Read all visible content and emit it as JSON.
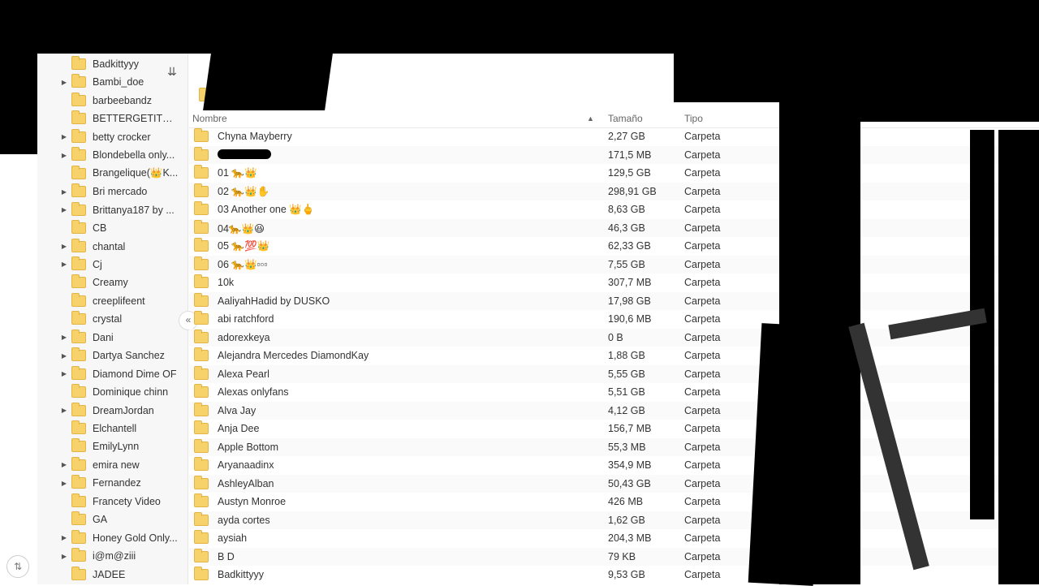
{
  "toolbar": {
    "sort_icon": "sort-icon",
    "collapse_icon": "double-chevron-left-icon",
    "corner_icon": "refresh-icon"
  },
  "sidebar": {
    "items": [
      {
        "label": "Badkittyyy",
        "expandable": false
      },
      {
        "label": "Bambi_doe",
        "expandable": true
      },
      {
        "label": "barbeebandz",
        "expandable": false
      },
      {
        "label": "BETTERGETITRI...",
        "expandable": false
      },
      {
        "label": "betty crocker",
        "expandable": true
      },
      {
        "label": "Blondebella only...",
        "expandable": true
      },
      {
        "label": "Brangelique(👑K...",
        "expandable": false
      },
      {
        "label": "Bri mercado",
        "expandable": true
      },
      {
        "label": "Brittanya187 by ...",
        "expandable": true
      },
      {
        "label": "CB",
        "expandable": false
      },
      {
        "label": "chantal",
        "expandable": true
      },
      {
        "label": "Cj",
        "expandable": true
      },
      {
        "label": "Creamy",
        "expandable": false
      },
      {
        "label": "creeplifeent",
        "expandable": false
      },
      {
        "label": "crystal",
        "expandable": false
      },
      {
        "label": "Dani",
        "expandable": true
      },
      {
        "label": "Dartya Sanchez",
        "expandable": true
      },
      {
        "label": "Diamond Dime OF",
        "expandable": true
      },
      {
        "label": "Dominique chinn",
        "expandable": false
      },
      {
        "label": "DreamJordan",
        "expandable": true
      },
      {
        "label": "Elchantell",
        "expandable": false
      },
      {
        "label": "EmilyLynn",
        "expandable": false
      },
      {
        "label": "emira new",
        "expandable": true
      },
      {
        "label": "Fernandez",
        "expandable": true
      },
      {
        "label": "Francety Video",
        "expandable": false
      },
      {
        "label": "GA",
        "expandable": false
      },
      {
        "label": "Honey Gold Only...",
        "expandable": true
      },
      {
        "label": "i@m@ziii",
        "expandable": true
      },
      {
        "label": "JADEE",
        "expandable": false
      }
    ]
  },
  "table": {
    "columns": {
      "name": "Nombre",
      "size": "Tamaño",
      "type": "Tipo"
    },
    "rows": [
      {
        "name": "Chyna Mayberry",
        "size": "2,27 GB",
        "type": "Carpeta"
      },
      {
        "name": "",
        "size": "171,5 MB",
        "type": "Carpeta"
      },
      {
        "name": "01 🐆👑",
        "size": "129,5 GB",
        "type": "Carpeta"
      },
      {
        "name": "02 🐆👑✋",
        "size": "298,91 GB",
        "type": "Carpeta"
      },
      {
        "name": "03 Another one 👑🖕",
        "size": "8,63 GB",
        "type": "Carpeta"
      },
      {
        "name": "04🐆👑😆",
        "size": "46,3 GB",
        "type": "Carpeta"
      },
      {
        "name": "05 🐆💯👑",
        "size": "62,33 GB",
        "type": "Carpeta"
      },
      {
        "name": "06 🐆👑▫▫▫",
        "size": "7,55 GB",
        "type": "Carpeta"
      },
      {
        "name": "10k",
        "size": "307,7 MB",
        "type": "Carpeta"
      },
      {
        "name": "AaliyahHadid by DUSKO",
        "size": "17,98 GB",
        "type": "Carpeta"
      },
      {
        "name": "abi ratchford",
        "size": "190,6 MB",
        "type": "Carpeta"
      },
      {
        "name": "adorexkeya",
        "size": "0 B",
        "type": "Carpeta"
      },
      {
        "name": "Alejandra Mercedes DiamondKay",
        "size": "1,88 GB",
        "type": "Carpeta"
      },
      {
        "name": "Alexa Pearl",
        "size": "5,55 GB",
        "type": "Carpeta"
      },
      {
        "name": "Alexas onlyfans",
        "size": "5,51 GB",
        "type": "Carpeta"
      },
      {
        "name": "Alva Jay",
        "size": "4,12 GB",
        "type": "Carpeta"
      },
      {
        "name": "Anja Dee",
        "size": "156,7 MB",
        "type": "Carpeta"
      },
      {
        "name": "Apple Bottom",
        "size": "55,3 MB",
        "type": "Carpeta"
      },
      {
        "name": "Aryanaadinx",
        "size": "354,9 MB",
        "type": "Carpeta"
      },
      {
        "name": "AshleyAlban",
        "size": "50,43 GB",
        "type": "Carpeta"
      },
      {
        "name": "Austyn Monroe",
        "size": "426 MB",
        "type": "Carpeta"
      },
      {
        "name": "ayda cortes",
        "size": "1,62 GB",
        "type": "Carpeta"
      },
      {
        "name": "aysiah",
        "size": "204,3 MB",
        "type": "Carpeta"
      },
      {
        "name": "B D",
        "size": "79 KB",
        "type": "Carpeta"
      },
      {
        "name": "Badkittyyy",
        "size": "9,53 GB",
        "type": "Carpeta"
      }
    ]
  }
}
